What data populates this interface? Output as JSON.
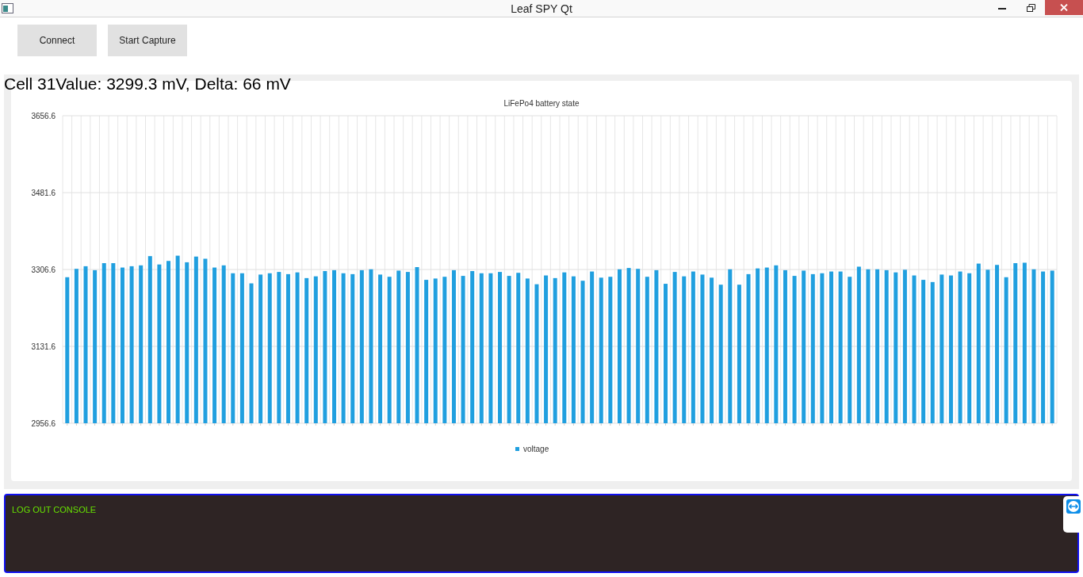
{
  "window": {
    "title": "Leaf SPY Qt"
  },
  "buttons": [
    "Connect",
    "Start Capture"
  ],
  "cell_info": "Cell 31Value: 3299.3 mV, Delta: 66 mV",
  "chart": {
    "chart_data": {
      "type": "bar",
      "grid": true,
      "title": "LiFePo4 battery state",
      "ylim": [
        2956.6,
        3656.6
      ],
      "yticks": [
        {
          "value": 2956.6,
          "label": "2956.6"
        },
        {
          "value": 3131.6,
          "label": "3131.6"
        },
        {
          "value": 3306.6,
          "label": "3306.6"
        },
        {
          "value": 3481.6,
          "label": "3481.6"
        },
        {
          "value": 3656.6,
          "label": "3656.6"
        }
      ],
      "series": [
        {
          "name": "voltage",
          "color": "#209fdf",
          "values": [
            3289,
            3308,
            3314,
            3305,
            3321,
            3321,
            3311,
            3314,
            3316,
            3337,
            3318,
            3326,
            3338,
            3323,
            3336,
            3331,
            3311,
            3316,
            3298,
            3298,
            3275,
            3295,
            3298,
            3301,
            3296,
            3300,
            3287,
            3291,
            3303,
            3305,
            3298,
            3296,
            3305,
            3307,
            3295,
            3290,
            3304,
            3301,
            3312,
            3283,
            3286,
            3290,
            3305,
            3292,
            3303,
            3298,
            3298,
            3301,
            3292,
            3299,
            3286,
            3273,
            3293,
            3287,
            3300,
            3291,
            3281,
            3302,
            3288,
            3290,
            3307,
            3310,
            3308,
            3290,
            3305,
            3274,
            3301,
            3291,
            3302,
            3295,
            3288,
            3272,
            3307,
            3272,
            3296,
            3309,
            3311,
            3316,
            3305,
            3292,
            3304,
            3296,
            3298,
            3302,
            3302,
            3290,
            3313,
            3307,
            3307,
            3305,
            3300,
            3306,
            3293,
            3283,
            3278,
            3295,
            3293,
            3302,
            3298,
            3320,
            3306,
            3317,
            3289,
            3321,
            3322,
            3307,
            3302,
            3304
          ]
        }
      ]
    }
  },
  "console": {
    "title": "LOG OUT CONSOLE"
  }
}
